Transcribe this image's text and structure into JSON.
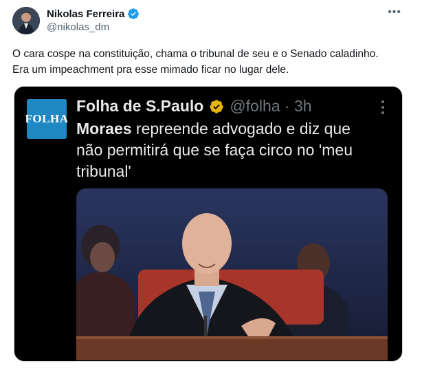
{
  "tweet": {
    "display_name": "Nikolas Ferreira",
    "handle": "@nikolas_dm",
    "more_icon": "ellipsis-icon",
    "text": "O cara cospe na constituição, chama o tribunal de seu e o Senado caladinho. Era um impeachment pra esse mimado ficar no lugar dele."
  },
  "embedded": {
    "logo_text": "FOLHA",
    "name": "Folha de S.Paulo",
    "handle": "@folha · 3h",
    "bold": "Moraes",
    "text_rest": " repreende advogado e diz que não permitirá que se faça circo no 'meu tribunal'"
  },
  "colors": {
    "verified_blue": "#1d9bf0",
    "verified_gold": "#f0b90b",
    "folha_blue": "#1f87c2"
  }
}
